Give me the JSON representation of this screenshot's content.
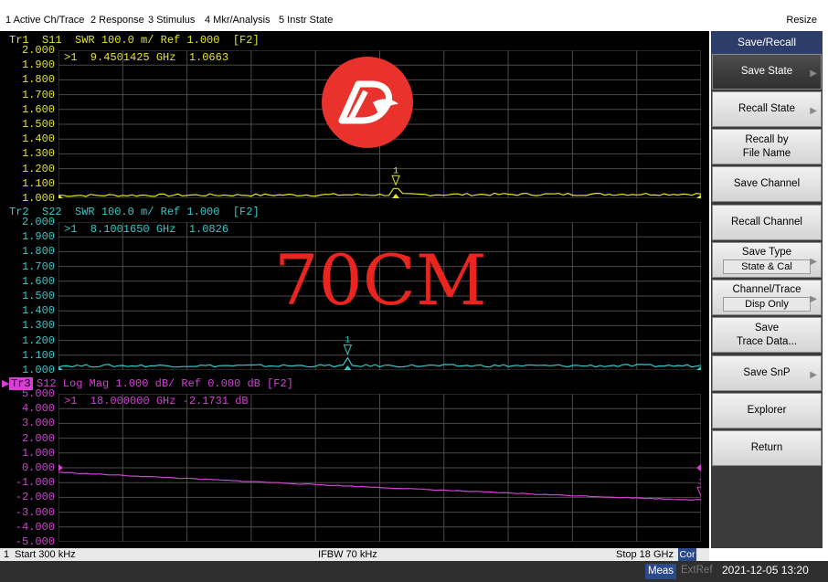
{
  "menubar": {
    "items": [
      "1 Active Ch/Trace",
      "2 Response",
      "3 Stimulus",
      "4 Mkr/Analysis",
      "5 Instr State"
    ],
    "resize": "Resize"
  },
  "colors": {
    "trace1": "#e6e61e",
    "trace2": "#35c8c8",
    "trace3": "#d540d5",
    "grid": "#4a4a4a"
  },
  "traces": [
    {
      "id": "Tr1",
      "title": "Tr1  S11  SWR 100.0 m/ Ref 1.000  [F2]",
      "marker_readout": ">1  9.4501425 GHz  1.0663",
      "marker_label": "1",
      "ylabels": [
        "2.000",
        "1.900",
        "1.800",
        "1.700",
        "1.600",
        "1.500",
        "1.400",
        "1.300",
        "1.200",
        "1.100",
        "1.000"
      ],
      "ymin": 1.0,
      "ymax": 2.0,
      "marker_x": 9.4501425,
      "marker_y": 1.0663
    },
    {
      "id": "Tr2",
      "title": "Tr2  S22  SWR 100.0 m/ Ref 1.000  [F2]",
      "marker_readout": ">1  8.1001650 GHz  1.0826",
      "marker_label": "1",
      "ylabels": [
        "2.000",
        "1.900",
        "1.800",
        "1.700",
        "1.600",
        "1.500",
        "1.400",
        "1.300",
        "1.200",
        "1.100",
        "1.000"
      ],
      "ymin": 1.0,
      "ymax": 2.0,
      "marker_x": 8.100165,
      "marker_y": 1.0826
    },
    {
      "id": "Tr3",
      "badge": "Tr3",
      "title": "S12 Log Mag 1.000 dB/ Ref 0.000 dB [F2]",
      "marker_readout": ">1  18.000000 GHz -2.1731 dB",
      "marker_label": "1",
      "ylabels": [
        "5.000",
        "4.000",
        "3.000",
        "2.000",
        "1.000",
        "0.000",
        "-1.000",
        "-2.000",
        "-3.000",
        "-4.000",
        "-5.000"
      ],
      "ymin": -5.0,
      "ymax": 5.0,
      "marker_x": 18.0,
      "marker_y": -2.1731
    }
  ],
  "watermark": "70CM",
  "softkeys": {
    "header": "Save/Recall",
    "items": [
      {
        "label": "Save State"
      },
      {
        "label": "Recall State"
      },
      {
        "label": "Recall by\nFile Name"
      },
      {
        "label": "Save Channel"
      },
      {
        "label": "Recall Channel"
      },
      {
        "label": "Save Type",
        "sub": "State & Cal"
      },
      {
        "label": "Channel/Trace",
        "sub": "Disp Only"
      },
      {
        "label": "Save\nTrace Data..."
      },
      {
        "label": "Save SnP"
      },
      {
        "label": "Explorer"
      },
      {
        "label": "Return"
      }
    ]
  },
  "statusbar": {
    "channel": "1",
    "start": "Start 300 kHz",
    "ifbw": "IFBW 70 kHz",
    "stop": "Stop 18 GHz",
    "cor": "Cor"
  },
  "bottombar": {
    "meas": "Meas",
    "extref": "ExtRef",
    "datetime": "2021-12-05 13:20"
  },
  "chart_data": {
    "type": "line",
    "x_range_ghz": [
      0.0003,
      18
    ],
    "series": [
      {
        "name": "S11",
        "format": "SWR",
        "start": 1.01,
        "end": 1.02,
        "peak_x": 9.4501425,
        "peak_y": 1.0663
      },
      {
        "name": "S22",
        "format": "SWR",
        "start": 1.02,
        "end": 1.02,
        "peak_x": 8.100165,
        "peak_y": 1.0826
      },
      {
        "name": "S12",
        "format": "Log Mag",
        "start": -0.3,
        "end": -2.1731
      }
    ]
  }
}
